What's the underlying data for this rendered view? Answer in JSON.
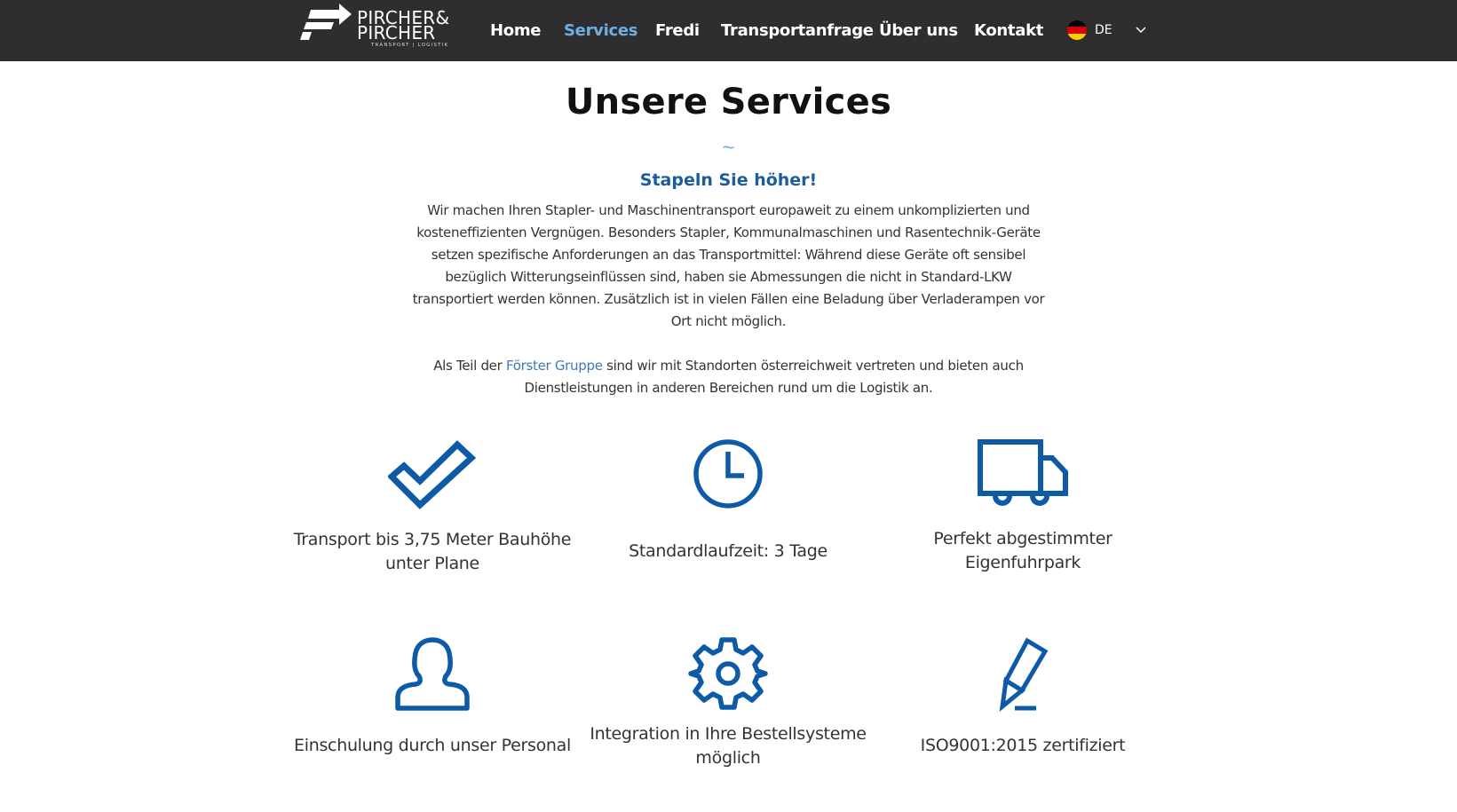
{
  "navbar": {
    "logo": {
      "line1": "PIRCHER&",
      "line2": "PIRCHER",
      "tagline": "TRANSPORT | LOGISTIK"
    },
    "items": [
      {
        "label": "Home",
        "active": false
      },
      {
        "label": "Services",
        "active": true
      },
      {
        "label": "Fredi",
        "active": false
      },
      {
        "label": "Transportanfrage",
        "active": false
      },
      {
        "label": "Über uns",
        "active": false
      },
      {
        "label": "Kontakt",
        "active": false
      }
    ],
    "language": {
      "code": "DE",
      "flag_icon": "germany-flag-icon",
      "chevron_icon": "chevron-down-icon"
    }
  },
  "main": {
    "title": "Unsere Services",
    "divider": "~",
    "subtitle": "Stapeln Sie höher!",
    "paragraph1": "Wir machen Ihren Stapler- und Maschinentransport europaweit zu einem unkomplizierten und kosteneffizienten Vergnügen. Besonders Stapler, Kommunalmaschinen und Rasentechnik-Geräte setzen spezifische Anforderungen an das Transportmittel: Während diese Geräte oft sensibel bezüglich Witterungseinflüssen sind, haben sie Abmessungen die nicht in Standard-LKW transportiert werden können. Zusätzlich ist in vielen Fällen eine Beladung über Verladerampen vor Ort nicht möglich.",
    "paragraph2_before": "Als Teil der ",
    "paragraph2_link": "Förster Gruppe",
    "paragraph2_after": " sind wir mit Standorten österreichweit vertreten und bieten auch Dienstleistungen in anderen Bereichen rund um die Logistik an.",
    "features": [
      {
        "icon": "checkmark-icon",
        "label": "Transport bis 3,75 Meter Bauhöhe unter Plane"
      },
      {
        "icon": "clock-icon",
        "label": "Standardlaufzeit: 3 Tage"
      },
      {
        "icon": "truck-icon",
        "label": "Perfekt abgestimmter Eigenfuhrpark"
      },
      {
        "icon": "person-icon",
        "label": "Einschulung durch unser Personal"
      },
      {
        "icon": "gear-icon",
        "label": "Integration in Ihre Bestellsysteme möglich"
      },
      {
        "icon": "pencil-icon",
        "label": "ISO9001:2015 zertifiziert"
      }
    ]
  },
  "colors": {
    "navbar_bg": "#2e2e30",
    "nav_active": "#6faee0",
    "accent_blue": "#1b5c9c",
    "icon_blue": "#0d5aa7",
    "link": "#3d7ab8"
  }
}
